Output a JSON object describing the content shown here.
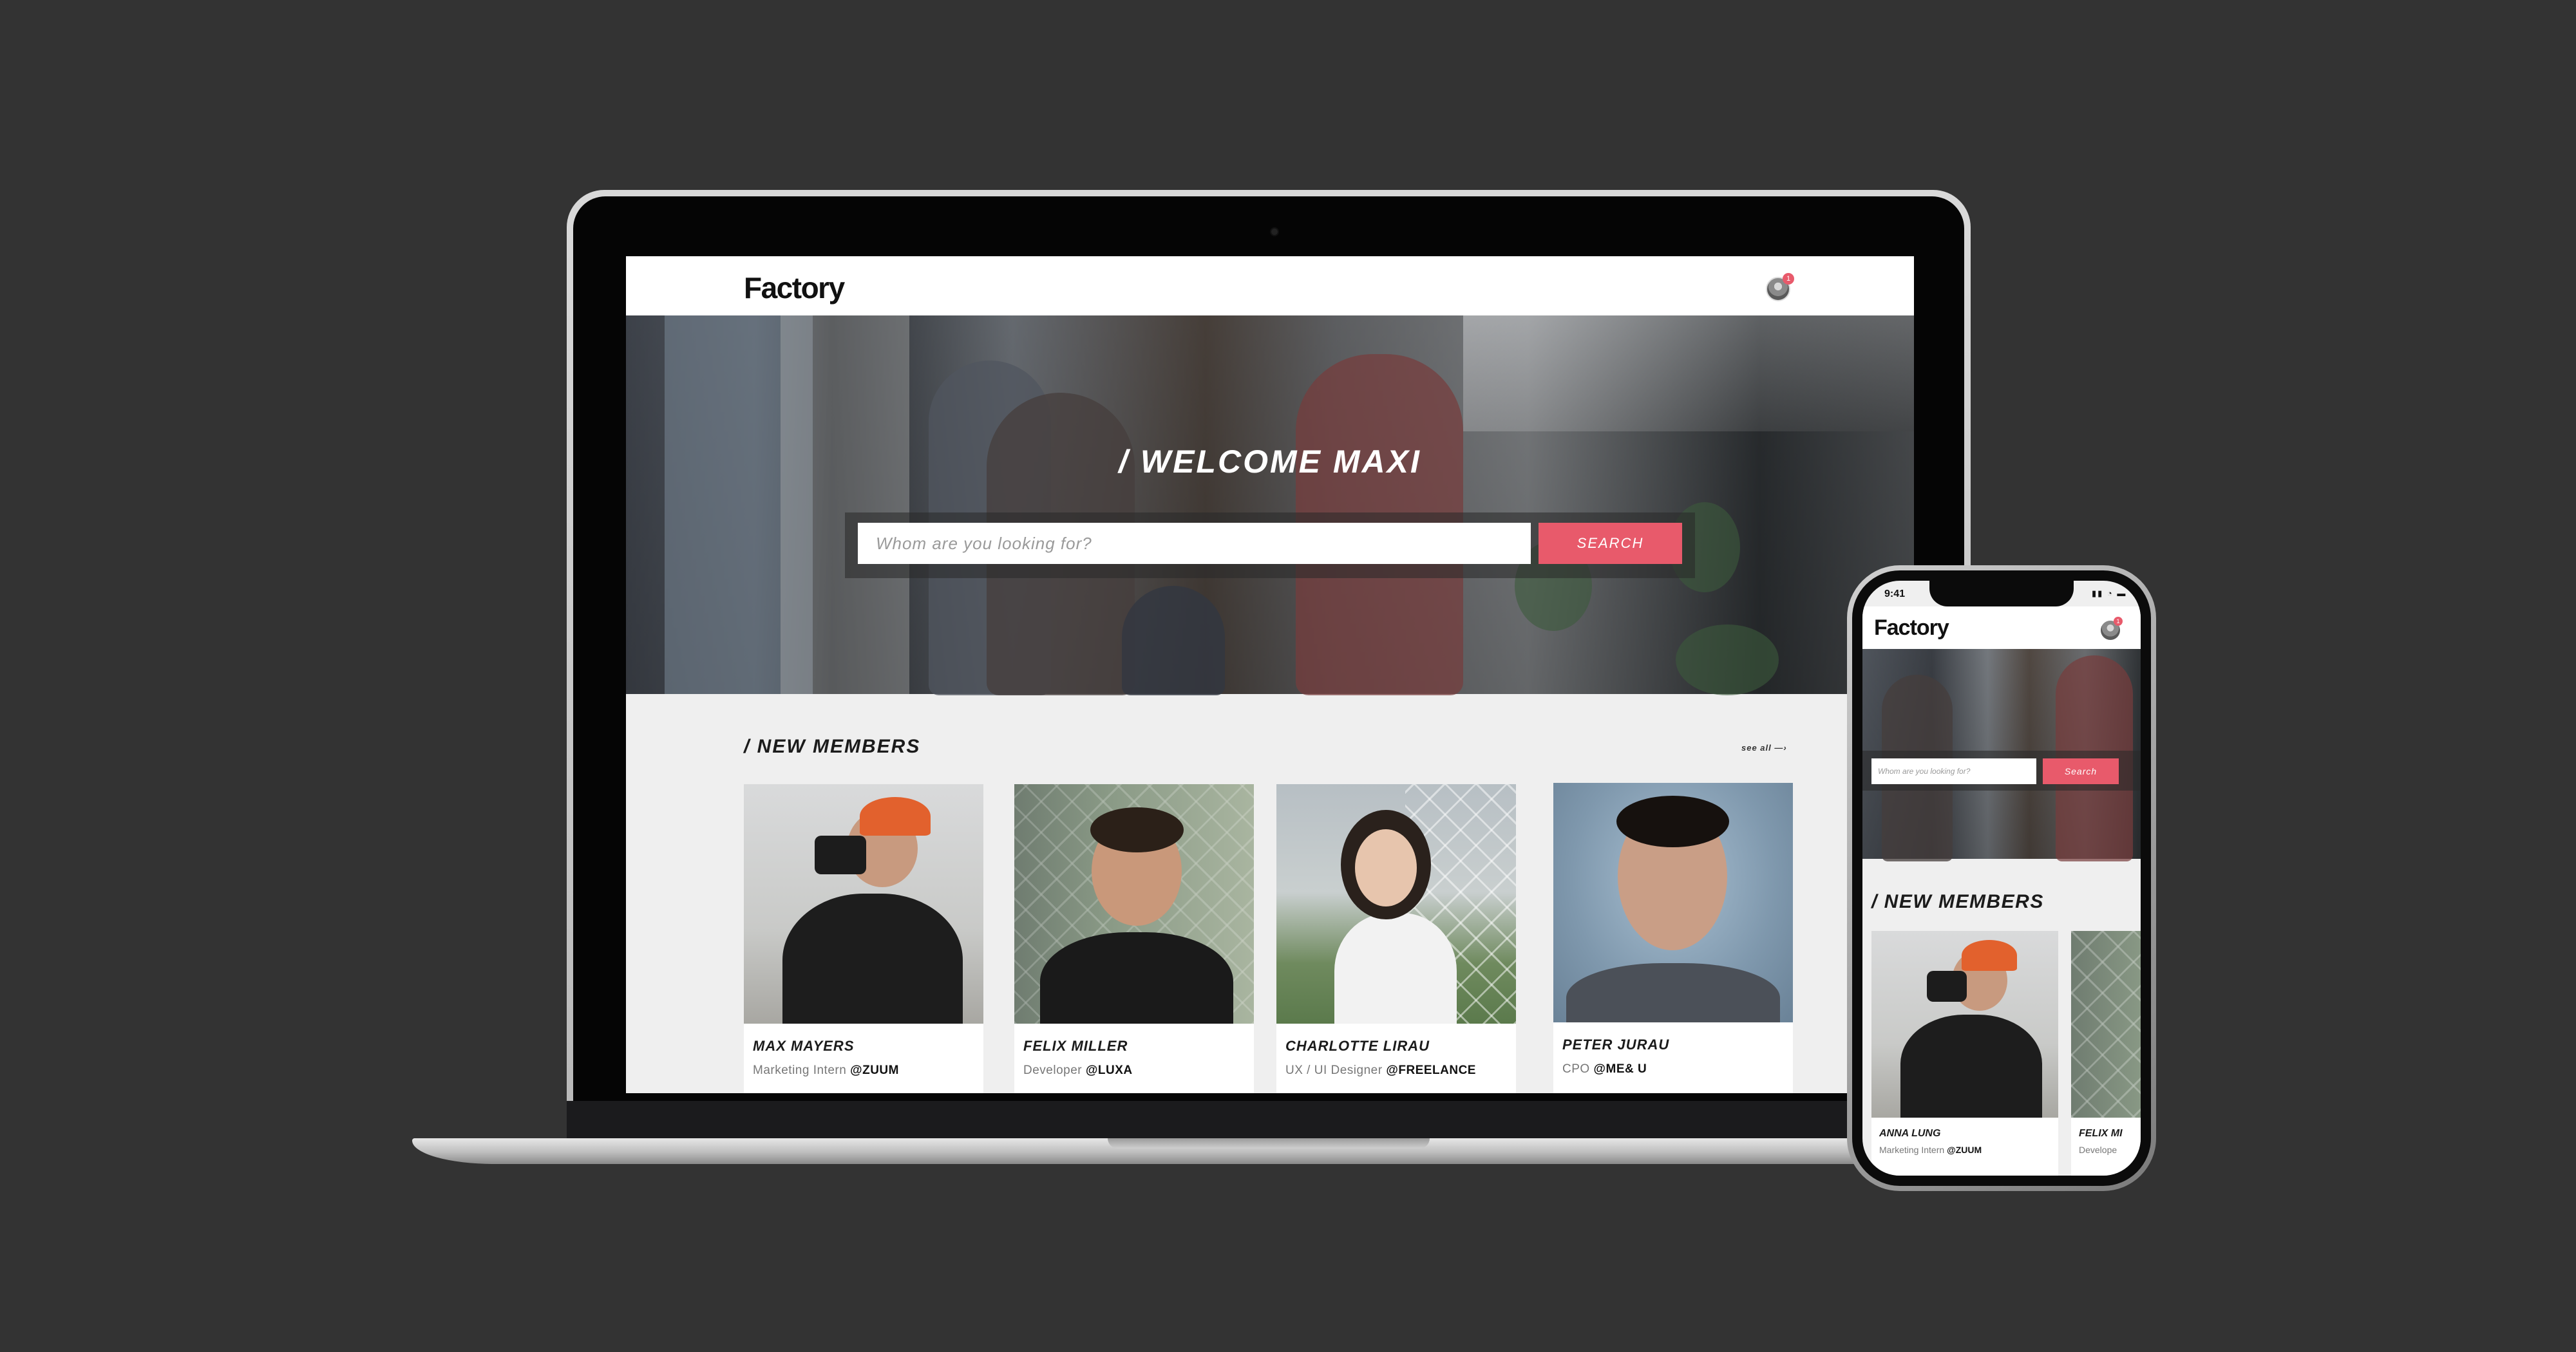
{
  "colors": {
    "accent": "#e85a6b",
    "background": "#333333",
    "page": "#efefef"
  },
  "header": {
    "logo": "Factory",
    "notification_count": "1",
    "avatar_icon": "user-avatar-icon"
  },
  "hero": {
    "title": "/ WELCOME MAXI",
    "search_placeholder": "Whom are you looking for?",
    "search_button": "SEARCH"
  },
  "new_members": {
    "title": "/ NEW MEMBERS",
    "see_all": "see all —›",
    "members": [
      {
        "name": "MAX MAYERS",
        "role": "Marketing Intern",
        "company": "@ZUUM"
      },
      {
        "name": "FELIX MILLER",
        "role": "Developer",
        "company": "@LUXA"
      },
      {
        "name": "CHARLOTTE LIRAU",
        "role": "UX / UI Designer",
        "company": "@FREELANCE"
      },
      {
        "name": "PETER JURAU",
        "role": "CPO",
        "company": "@ME& U"
      }
    ]
  },
  "phone": {
    "time": "9:41",
    "status_icons": "▮▮ ◔ ▬",
    "logo": "Factory",
    "notification_count": "1",
    "search_placeholder": "Whom are you looking for?",
    "search_button": "Search",
    "section_title": "/ NEW MEMBERS",
    "members": [
      {
        "name": "ANNA LUNG",
        "role": "Marketing Intern",
        "company": "@ZUUM"
      },
      {
        "name": "FELIX MI",
        "role": "Develope",
        "company": ""
      }
    ]
  }
}
